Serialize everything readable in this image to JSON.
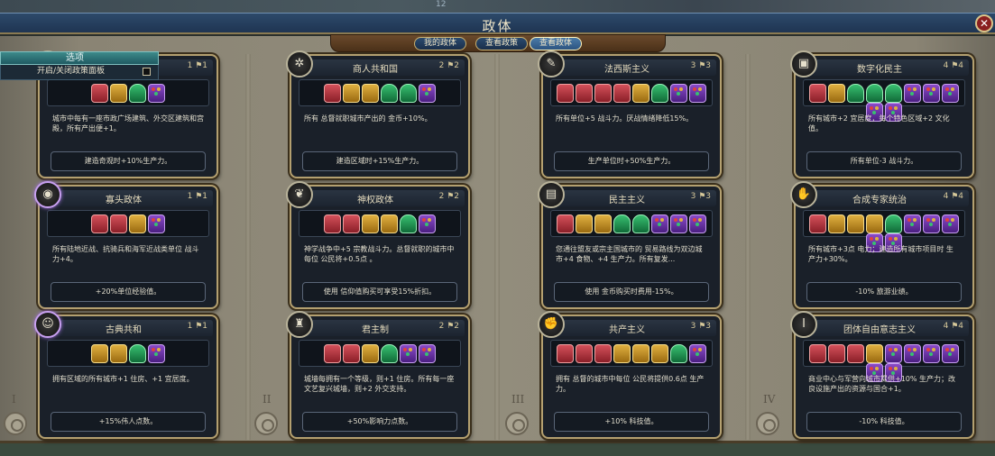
{
  "map_number": "12",
  "title": "政体",
  "close_label": "✕",
  "tabs": [
    "我的政体",
    "查看政策",
    "查看政体"
  ],
  "options": {
    "header": "选项",
    "toggle_label": "开启/关闭政策面板"
  },
  "column_numerals": [
    "I",
    "II",
    "III",
    "IV"
  ],
  "cards": [
    {
      "name": "",
      "cost": "1 ⚑1",
      "icon": "crown",
      "slots": [
        "military",
        "economic",
        "diplomatic",
        "wildcard"
      ],
      "bonus1": "城市中每有一座市政广场建筑、外交区建筑和宫殿，所有产出便+1。",
      "bonus2": "建造奇观时+10%生产力。"
    },
    {
      "name": "商人共和国",
      "cost": "2 ⚑2",
      "icon": "compass",
      "slots": [
        "military",
        "economic",
        "economic",
        "diplomatic",
        "diplomatic",
        "wildcard"
      ],
      "bonus1": "所有 总督就职城市产出的 金币+10%。",
      "bonus2": "建造区域时+15%生产力。"
    },
    {
      "name": "法西斯主义",
      "cost": "3 ⚑3",
      "icon": "torch",
      "slots": [
        "military",
        "military",
        "military",
        "military",
        "economic",
        "diplomatic",
        "wildcard",
        "wildcard"
      ],
      "bonus1": "所有单位+5 战斗力。厌战情绪降低15%。",
      "bonus2": "生产单位时+50%生产力。"
    },
    {
      "name": "数字化民主",
      "cost": "4 ⚑4",
      "icon": "screen",
      "slots": [
        "military",
        "economic",
        "diplomatic",
        "diplomatic",
        "diplomatic",
        "wildcard",
        "wildcard",
        "wildcard",
        "wildcard",
        "wildcard"
      ],
      "bonus1": "所有城市+2 宜居度，每个特色区域+2 文化值。",
      "bonus2": "所有单位-3 战斗力。"
    },
    {
      "name": "寡头政体",
      "cost": "1 ⚑1",
      "icon": "helmet",
      "slots": [
        "military",
        "military",
        "economic",
        "wildcard"
      ],
      "bonus1": "所有陆地近战、抗骑兵和海军近战类单位 战斗力+4。",
      "bonus2": "+20%单位经验值。"
    },
    {
      "name": "神权政体",
      "cost": "2 ⚑2",
      "icon": "wings",
      "slots": [
        "military",
        "military",
        "economic",
        "economic",
        "diplomatic",
        "wildcard"
      ],
      "bonus1": "神学战争中+5 宗教战斗力。总督就职的城市中每位 公民将+0.5点 。",
      "bonus2": "使用 信仰值购买可享受15%折扣。"
    },
    {
      "name": "民主主义",
      "cost": "3 ⚑3",
      "icon": "ballot",
      "slots": [
        "military",
        "economic",
        "economic",
        "diplomatic",
        "diplomatic",
        "wildcard",
        "wildcard",
        "wildcard"
      ],
      "bonus1": "您通往盟友或宗主国城市的 贸易路线为双边城市+4 食物、+4 生产力。所有复发...",
      "bonus2": "使用 金币购买时费用-15%。"
    },
    {
      "name": "合成专家统治",
      "cost": "4 ⚑4",
      "icon": "hand",
      "slots": [
        "military",
        "economic",
        "economic",
        "economic",
        "diplomatic",
        "wildcard",
        "wildcard",
        "wildcard",
        "wildcard",
        "wildcard"
      ],
      "bonus1": "所有城市+3点 电力；建造所有城市项目时 生产力+30%。",
      "bonus2": "-10% 旅游业绩。"
    },
    {
      "name": "古典共和",
      "cost": "1 ⚑1",
      "icon": "bust",
      "slots": [
        "economic",
        "economic",
        "diplomatic",
        "wildcard"
      ],
      "bonus1": "拥有区域的所有城市+1 住房、+1 宜居度。",
      "bonus2": "+15%伟人点数。"
    },
    {
      "name": "君主制",
      "cost": "2 ⚑2",
      "icon": "throne",
      "slots": [
        "military",
        "military",
        "economic",
        "diplomatic",
        "wildcard",
        "wildcard"
      ],
      "bonus1": "城墙每拥有一个等级，则+1 住房。所有每一座文艺复兴城墙，则+2 外交支持。",
      "bonus2": "+50%影响力点数。"
    },
    {
      "name": "共产主义",
      "cost": "3 ⚑3",
      "icon": "fist",
      "slots": [
        "military",
        "military",
        "military",
        "economic",
        "economic",
        "economic",
        "diplomatic",
        "wildcard"
      ],
      "bonus1": "拥有 总督的城市中每位 公民将提供0.6点 生产力。",
      "bonus2": "+10% 科技值。"
    },
    {
      "name": "团体自由意志主义",
      "cost": "4 ⚑4",
      "icon": "pillar",
      "slots": [
        "military",
        "military",
        "military",
        "economic",
        "wildcard",
        "wildcard",
        "wildcard",
        "wildcard",
        "wildcard",
        "wildcard"
      ],
      "bonus1": "商业中心与军营向城市提供+10% 生产力；改良设施产出的资源与国合+1。",
      "bonus2": "-10% 科技值。"
    }
  ]
}
